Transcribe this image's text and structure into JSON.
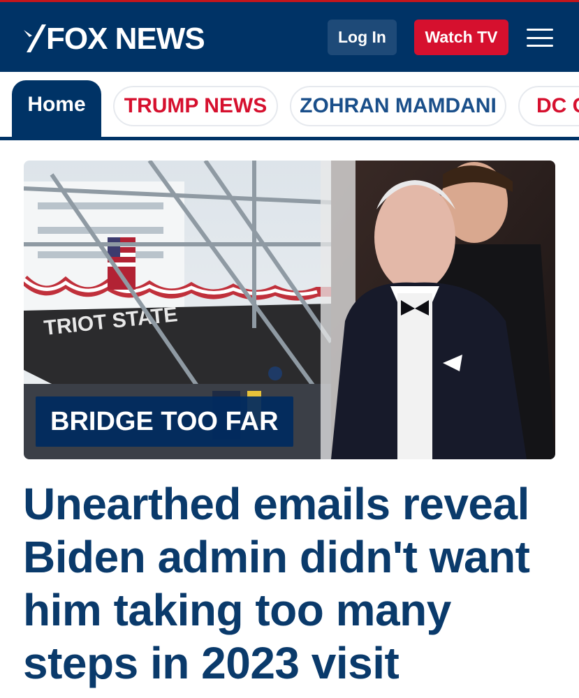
{
  "header": {
    "logo_text": "FOX NEWS",
    "login_label": "Log In",
    "watch_label": "Watch TV",
    "menu_icon": "hamburger-menu-icon",
    "brand_color": "#003366",
    "accent_color": "#d6102e"
  },
  "nav": {
    "tabs": [
      {
        "label": "Home",
        "active": true
      },
      {
        "label": "TRUMP NEWS"
      },
      {
        "label": "ZOHRAN MAMDANI"
      },
      {
        "label": "DC C"
      }
    ]
  },
  "hero": {
    "image_left_ship_text": "TRIOT STATE",
    "kicker": "BRIDGE TOO FAR"
  },
  "article": {
    "headline": "Unearthed emails reveal Biden admin didn't want him taking too many steps in 2023 visit"
  }
}
